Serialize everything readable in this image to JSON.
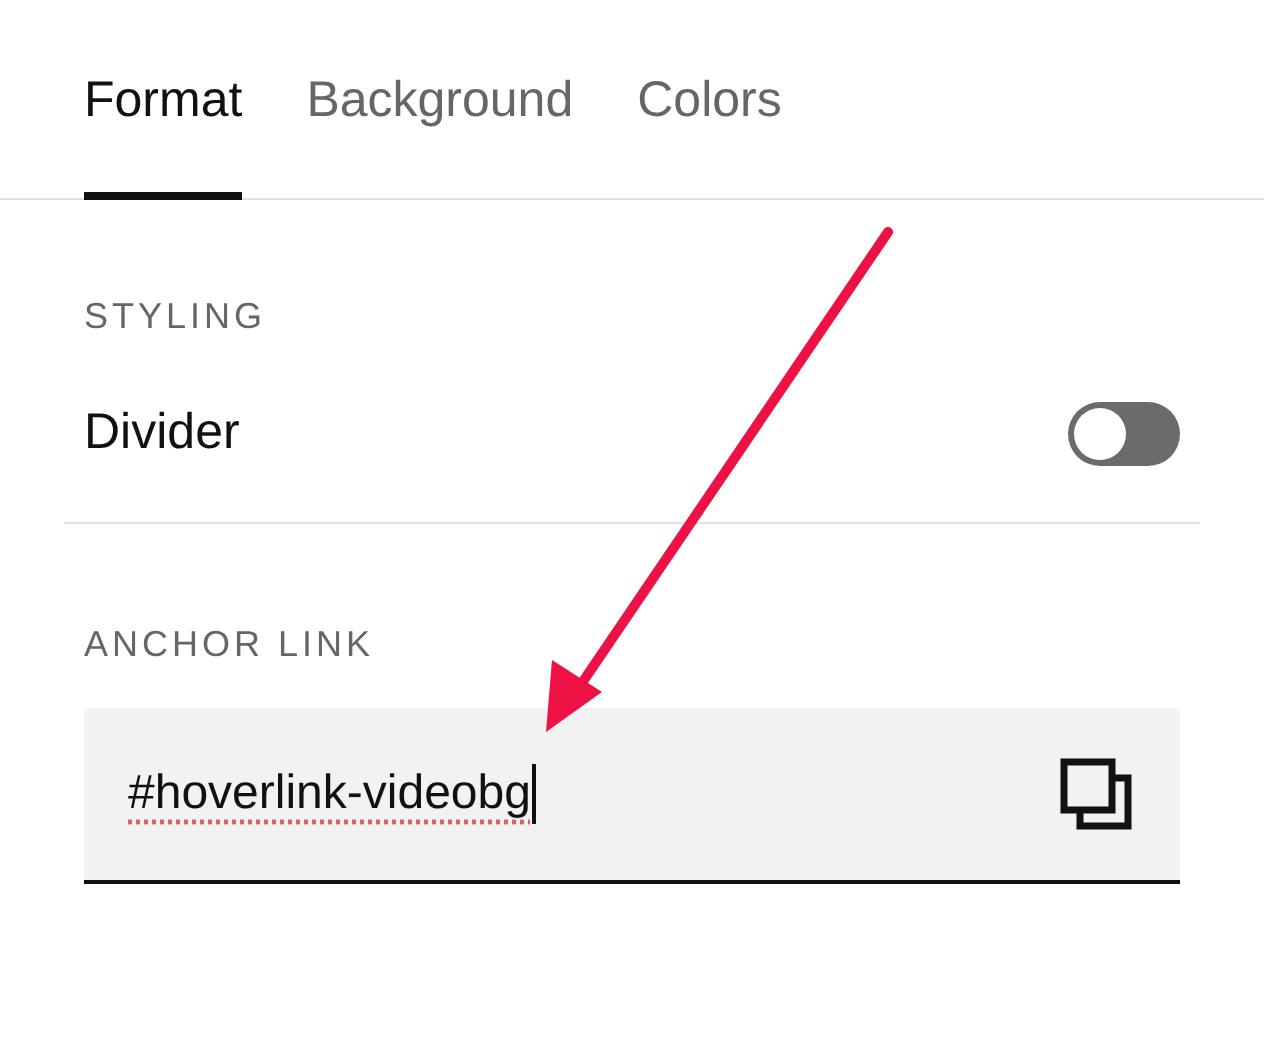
{
  "tabs": [
    {
      "label": "Format",
      "selected": true
    },
    {
      "label": "Background",
      "selected": false
    },
    {
      "label": "Colors",
      "selected": false
    }
  ],
  "styling": {
    "heading": "STYLING",
    "divider": {
      "label": "Divider",
      "on": false
    }
  },
  "anchor_link": {
    "heading": "ANCHOR LINK",
    "value": "#hoverlink-videobg",
    "focused": true
  }
}
